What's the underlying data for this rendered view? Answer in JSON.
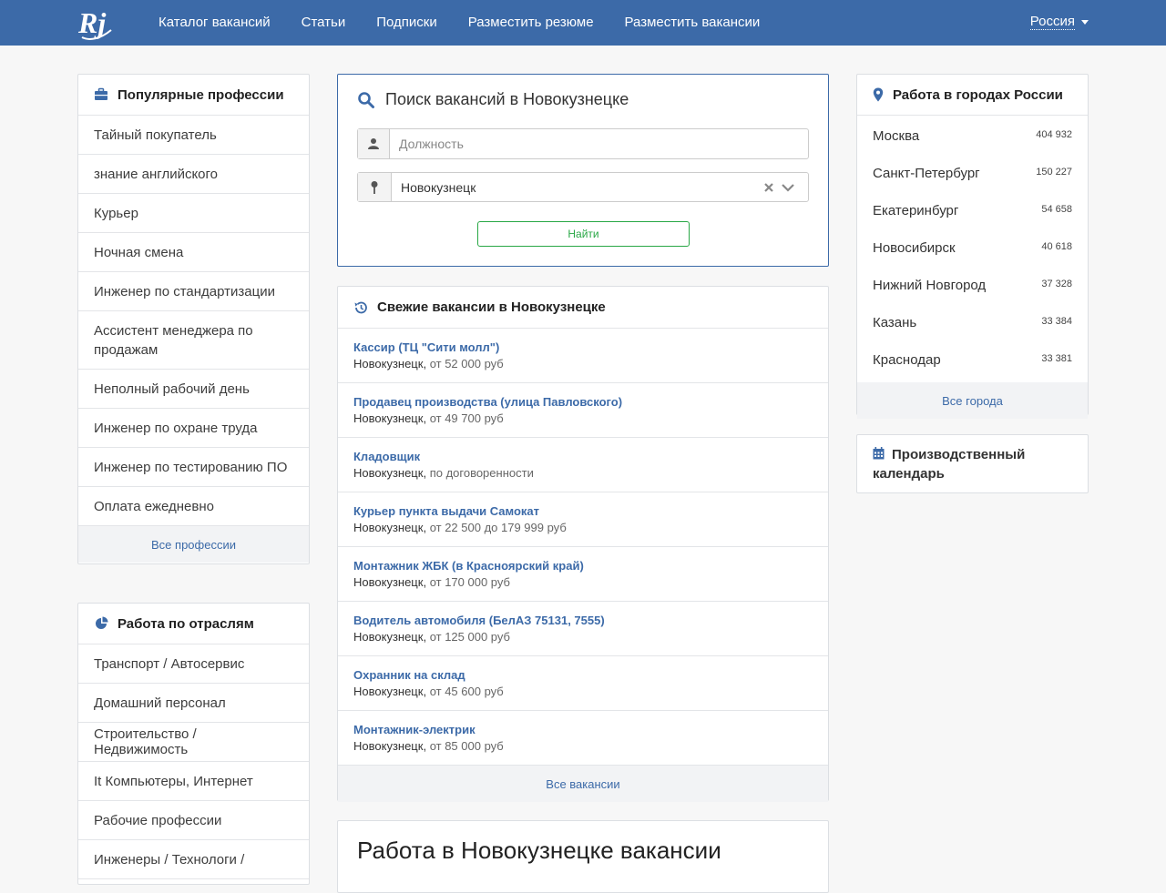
{
  "nav": {
    "logo_text": "Rj",
    "links": [
      "Каталог вакансий",
      "Статьи",
      "Подписки",
      "Разместить резюме",
      "Разместить вакансии"
    ],
    "region": "Россия"
  },
  "professions": {
    "title": "Популярные профессии",
    "items": [
      "Тайный покупатель",
      "знание английского",
      "Курьер",
      "Ночная смена",
      "Инженер по стандартизации",
      "Ассистент менеджера по продажам",
      "Неполный рабочий день",
      "Инженер по охране труда",
      "Инженер по тестированию ПО",
      "Оплата ежедневно"
    ],
    "footer": "Все профессии"
  },
  "industries": {
    "title": "Работа по отраслям",
    "items": [
      "Транспорт / Автосервис",
      "Домашний персонал",
      "Строительство / Недвижимость",
      "It Компьютеры, Интернет",
      "Рабочие профессии",
      "Инженеры / Технологи /"
    ]
  },
  "search": {
    "title": "Поиск вакансий в Новокузнецке",
    "position_placeholder": "Должность",
    "city_value": "Новокузнецк",
    "button": "Найти"
  },
  "fresh": {
    "title": "Свежие вакансии в Новокузнецке",
    "items": [
      {
        "title": "Кассир (ТЦ \"Сити молл\")",
        "city": "Новокузнецк,",
        "salary": "от 52 000 руб"
      },
      {
        "title": "Продавец производства (улица Павловского)",
        "city": "Новокузнецк,",
        "salary": "от 49 700 руб"
      },
      {
        "title": "Кладовщик",
        "city": "Новокузнецк,",
        "salary": "по договоренности"
      },
      {
        "title": "Курьер пункта выдачи Самокат",
        "city": "Новокузнецк,",
        "salary": "от 22 500 до 179 999 руб"
      },
      {
        "title": "Монтажник ЖБК (в Красноярский край)",
        "city": "Новокузнецк,",
        "salary": "от 170 000 руб"
      },
      {
        "title": "Водитель автомобиля (БелАЗ 75131, 7555)",
        "city": "Новокузнецк,",
        "salary": "от 125 000 руб"
      },
      {
        "title": "Охранник на склад",
        "city": "Новокузнецк,",
        "salary": "от 45 600 руб"
      },
      {
        "title": "Монтажник-электрик",
        "city": "Новокузнецк,",
        "salary": "от 85 000 руб"
      }
    ],
    "footer": "Все вакансии"
  },
  "work_heading": "Работа в Новокузнецке вакансии",
  "cities": {
    "title": "Работа в городах России",
    "items": [
      {
        "name": "Москва",
        "count": "404 932"
      },
      {
        "name": "Санкт-Петербург",
        "count": "150 227"
      },
      {
        "name": "Екатеринбург",
        "count": "54 658"
      },
      {
        "name": "Новосибирск",
        "count": "40 618"
      },
      {
        "name": "Нижний Новгород",
        "count": "37 328"
      },
      {
        "name": "Казань",
        "count": "33 384"
      },
      {
        "name": "Краснодар",
        "count": "33 381"
      }
    ],
    "footer": "Все города"
  },
  "calendar": {
    "title": "Производственный календарь"
  }
}
